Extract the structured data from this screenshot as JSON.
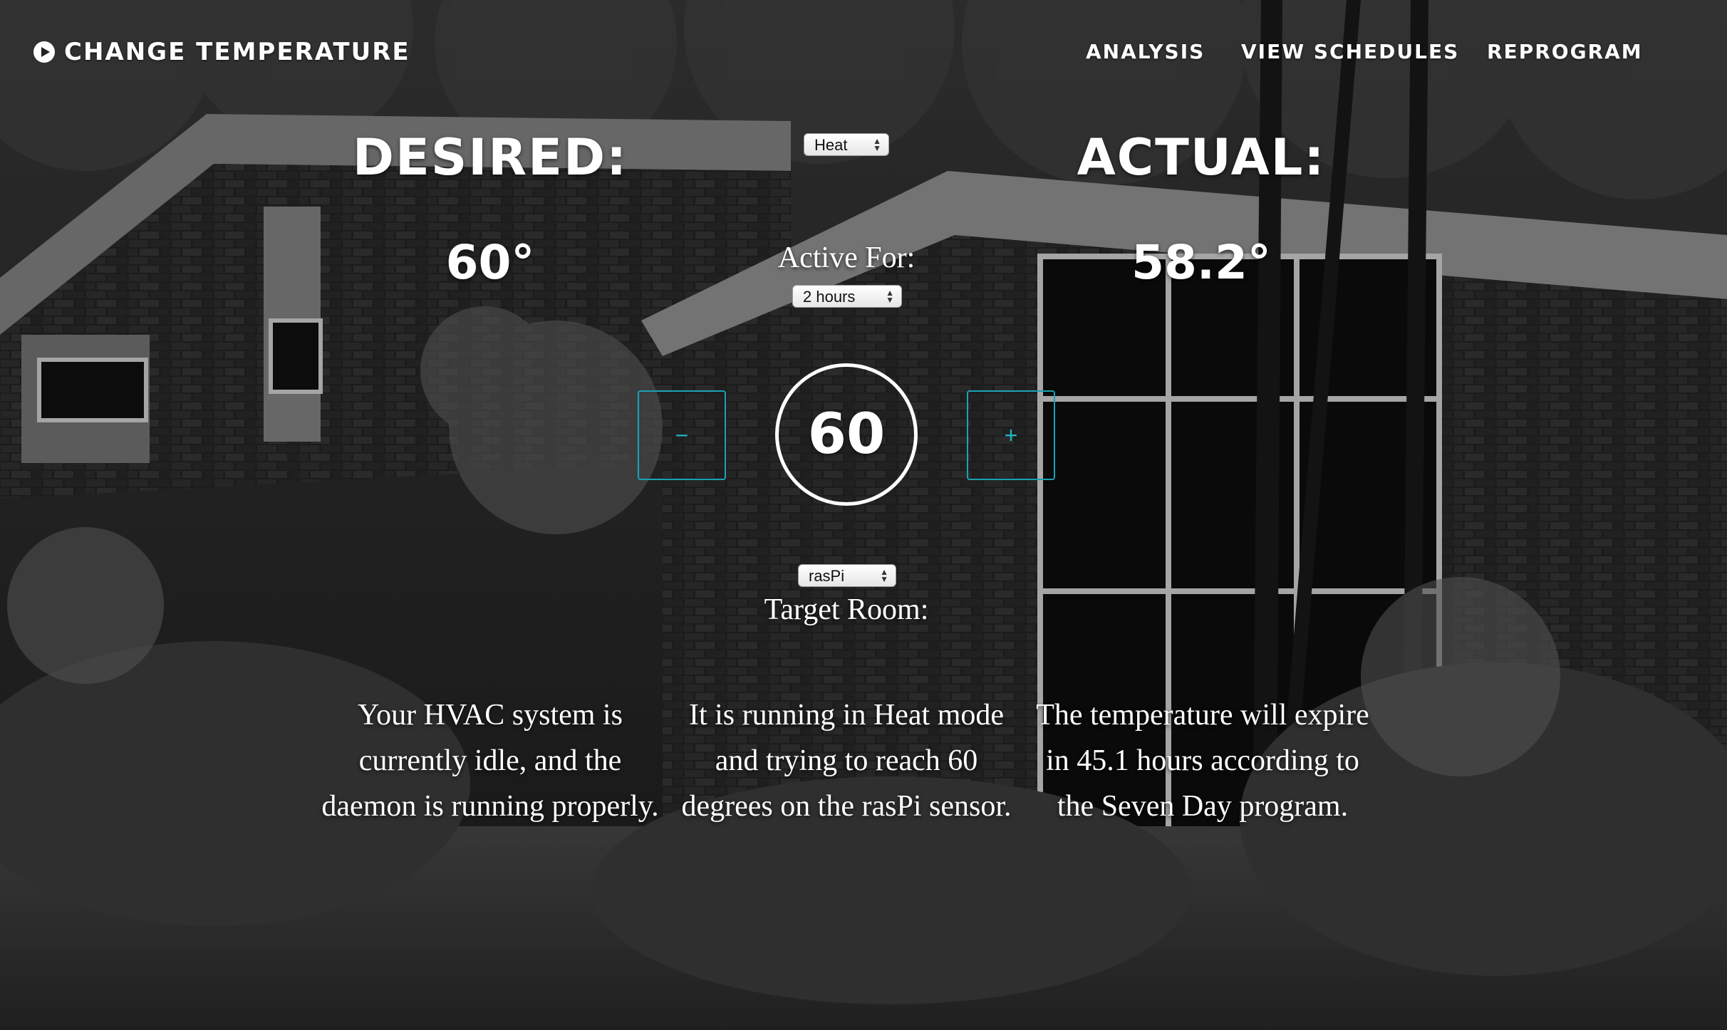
{
  "header": {
    "title": "CHANGE TEMPERATURE",
    "nav": [
      "ANALYSIS",
      "VIEW SCHEDULES",
      "REPROGRAM"
    ]
  },
  "desired": {
    "label": "DESIRED:",
    "value": "60°"
  },
  "actual": {
    "label": "ACTUAL:",
    "value": "58.2°"
  },
  "mode_select": {
    "value": "Heat"
  },
  "active_for": {
    "label": "Active For:",
    "value": "2 hours"
  },
  "stepper": {
    "minus": "−",
    "plus": "+",
    "current": "60"
  },
  "room_select": {
    "value": "rasPi",
    "label": "Target Room:"
  },
  "status": {
    "system": "Your HVAC system is currently idle, and the daemon is running properly.",
    "mode": "It is running in Heat mode and trying to reach 60 degrees on the rasPi sensor.",
    "expiry": "The temperature will expire in 45.1 hours according to the Seven Day program."
  },
  "colors": {
    "accent": "#1aa2b4",
    "text": "#ffffff"
  }
}
